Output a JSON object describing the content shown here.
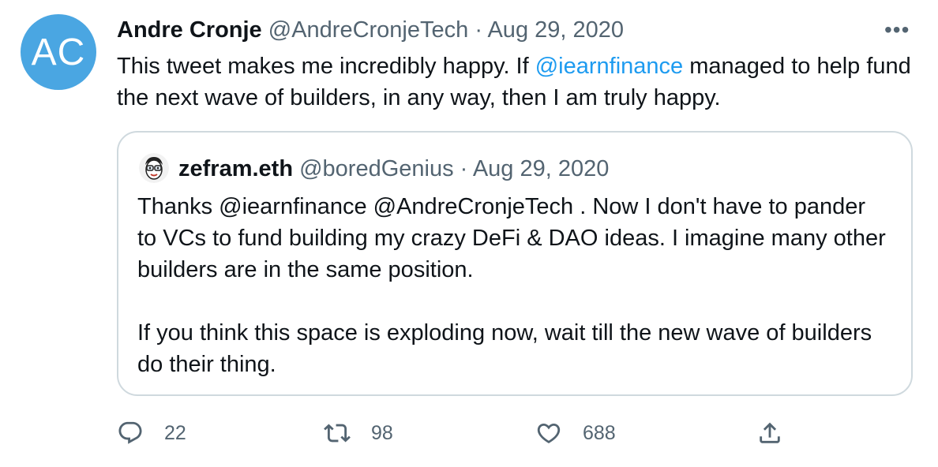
{
  "author": {
    "initials": "AC",
    "name": "Andre Cronje",
    "handle": "@AndreCronjeTech",
    "date": "Aug 29, 2020",
    "avatar_color": "#4aa6e2"
  },
  "tweet": {
    "text_before": "This tweet makes me incredibly happy. If ",
    "mention": "@iearnfinance",
    "text_after": " managed to help fund the next wave of builders, in any way, then I am truly happy."
  },
  "more_label": "•••",
  "quoted": {
    "name": "zefram.eth",
    "handle": "@boredGenius",
    "date": "Aug 29, 2020",
    "paragraph1": "Thanks @iearnfinance @AndreCronjeTech . Now I don't have to pander to VCs to fund building my crazy DeFi & DAO ideas. I imagine many other builders are in the same position.",
    "paragraph2": "If you think this space is exploding now, wait till the new wave of builders do their thing."
  },
  "actions": {
    "reply": {
      "icon": "reply-icon",
      "count": "22"
    },
    "retweet": {
      "icon": "retweet-icon",
      "count": "98"
    },
    "like": {
      "icon": "heart-icon",
      "count": "688"
    },
    "share": {
      "icon": "share-icon"
    }
  },
  "colors": {
    "accent": "#1d9bf0",
    "secondary_text": "#536471",
    "border": "#cfd9de"
  }
}
